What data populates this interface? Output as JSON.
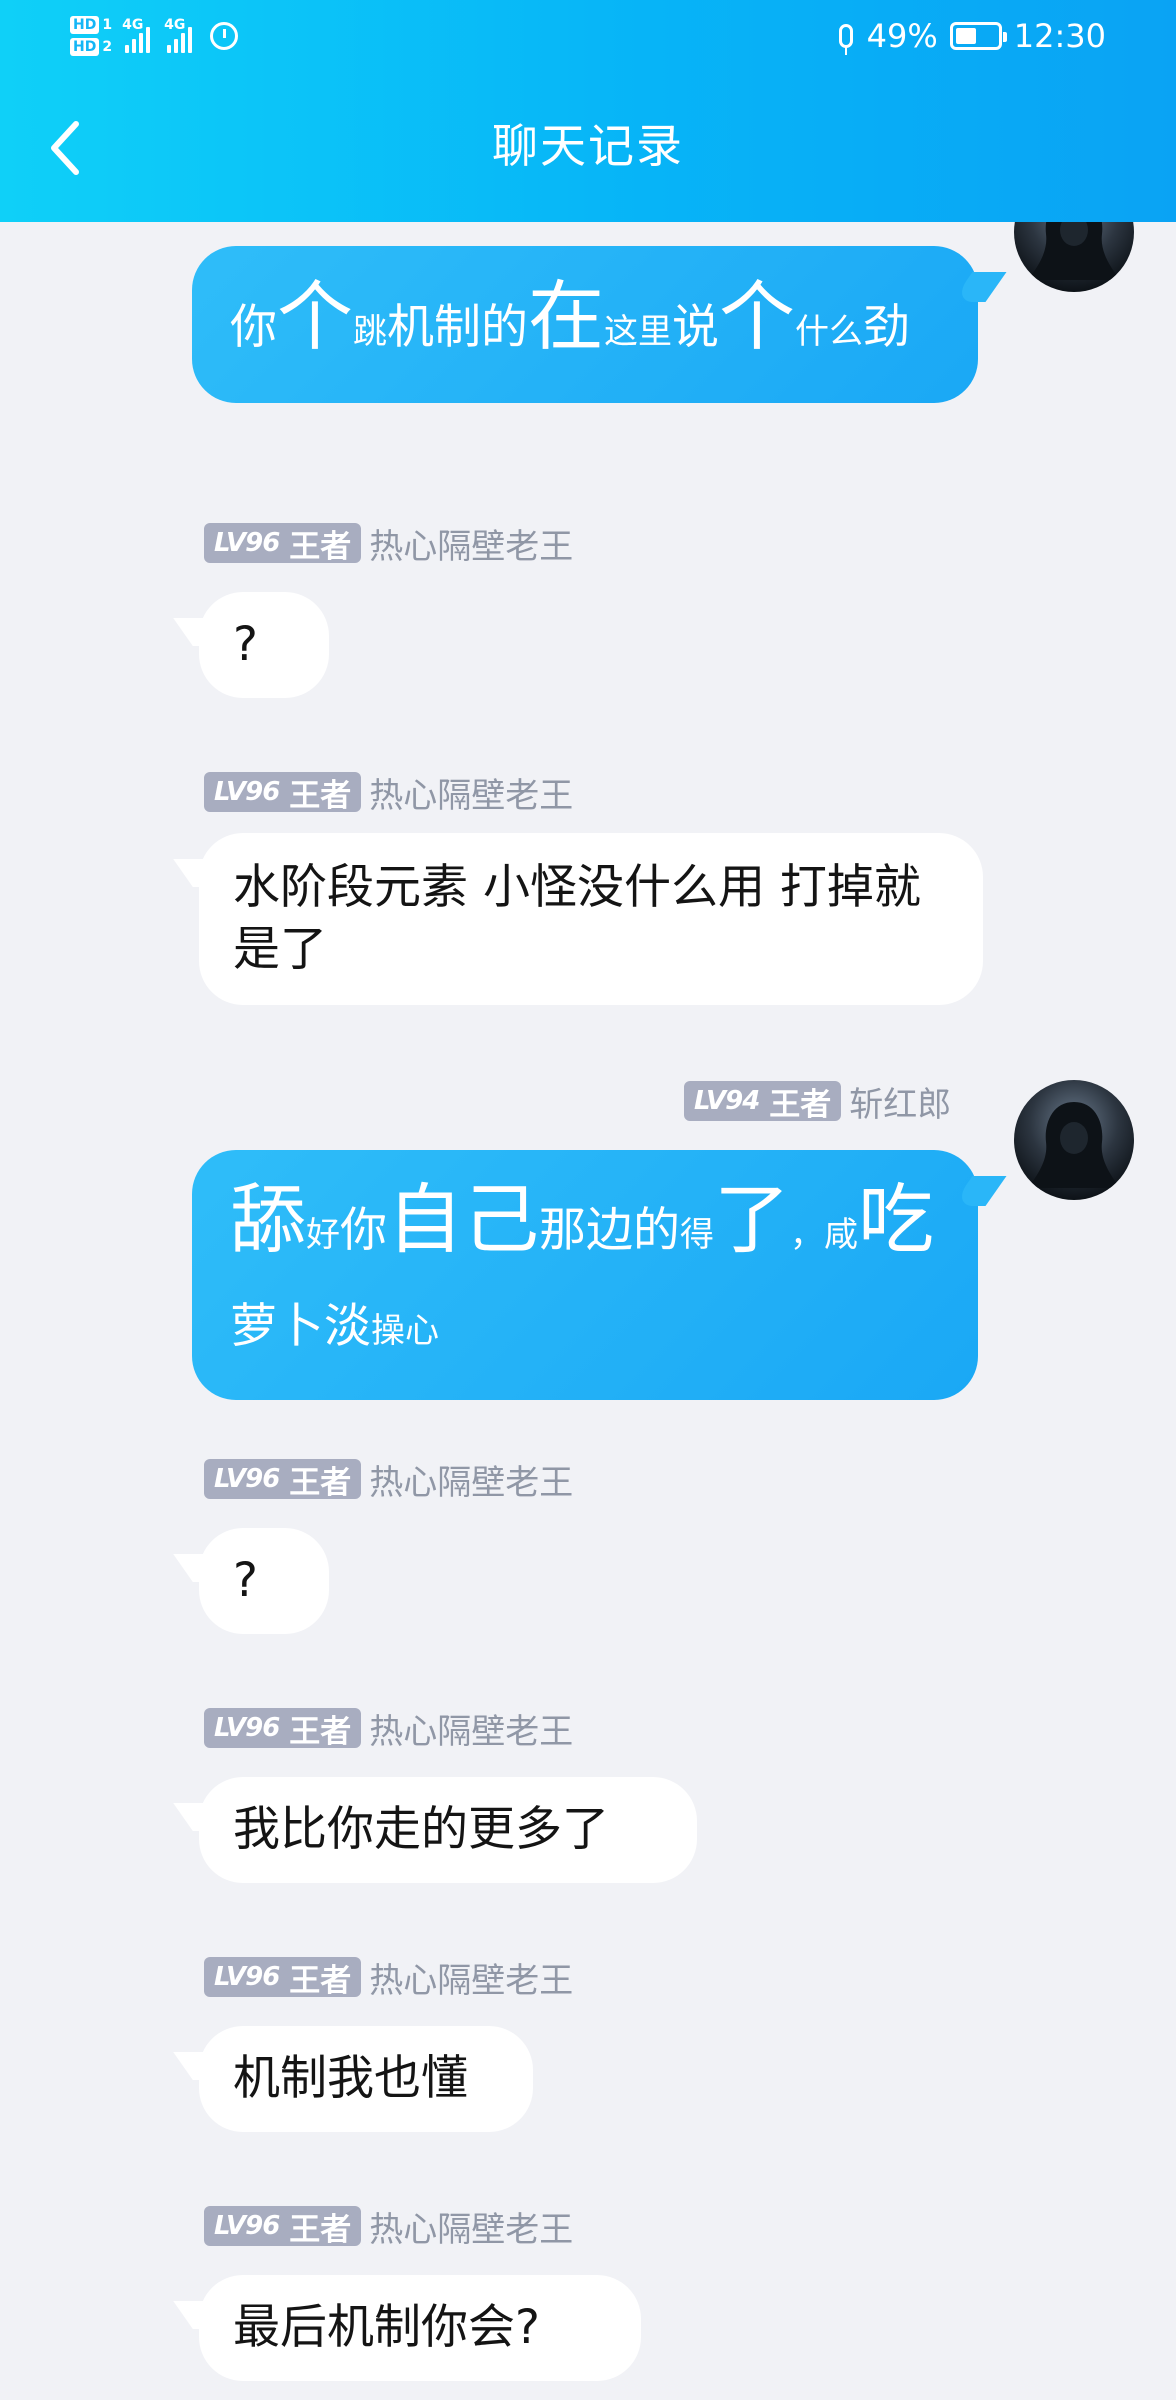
{
  "status_bar": {
    "sim1": "1",
    "sim2": "2",
    "hd": "HD",
    "net1": "4G",
    "net2": "4G",
    "battery_text": "49%",
    "battery_level": 0.49,
    "time": "12:30"
  },
  "header": {
    "title": "聊天记录"
  },
  "messages": [
    {
      "direction": "outgoing",
      "segments": [
        {
          "text": "你",
          "size": "m"
        },
        {
          "text": "个",
          "size": "xl"
        },
        {
          "text": "跳",
          "size": "s"
        },
        {
          "text": "机制的",
          "size": "m"
        },
        {
          "text": "在",
          "size": "xl"
        },
        {
          "text": "这里",
          "size": "s"
        },
        {
          "text": "说",
          "size": "m"
        },
        {
          "text": "个",
          "size": "xl"
        },
        {
          "text": "什么",
          "size": "s"
        },
        {
          "text": "劲",
          "size": "m"
        }
      ]
    },
    {
      "direction": "incoming",
      "level": "LV96",
      "rank": "王者",
      "sender": "热心隔壁老王",
      "text": "?"
    },
    {
      "direction": "incoming",
      "level": "LV96",
      "rank": "王者",
      "sender": "热心隔壁老王",
      "text": "水阶段元素 小怪没什么用 打掉就是了"
    },
    {
      "direction": "outgoing",
      "level": "LV94",
      "rank": "王者",
      "sender": "斩红郎",
      "segments": [
        {
          "text": "舔",
          "size": "xl"
        },
        {
          "text": "好",
          "size": "s"
        },
        {
          "text": "你",
          "size": "m"
        },
        {
          "text": "自己",
          "size": "xl"
        },
        {
          "text": "那边的",
          "size": "m"
        },
        {
          "text": "得",
          "size": "s"
        },
        {
          "text": "了",
          "size": "xl"
        },
        {
          "text": "，",
          "size": "s"
        },
        {
          "text": "咸",
          "size": "s"
        },
        {
          "text": "吃",
          "size": "xl"
        },
        {
          "text": "萝卜淡",
          "size": "m"
        },
        {
          "text": "操心",
          "size": "s"
        }
      ]
    },
    {
      "direction": "incoming",
      "level": "LV96",
      "rank": "王者",
      "sender": "热心隔壁老王",
      "text": "?"
    },
    {
      "direction": "incoming",
      "level": "LV96",
      "rank": "王者",
      "sender": "热心隔壁老王",
      "text": "我比你走的更多了"
    },
    {
      "direction": "incoming",
      "level": "LV96",
      "rank": "王者",
      "sender": "热心隔壁老王",
      "text": "机制我也懂"
    },
    {
      "direction": "incoming",
      "level": "LV96",
      "rank": "王者",
      "sender": "热心隔壁老王",
      "text": "最后机制你会?"
    }
  ],
  "colors": {
    "header_start": "#0fd0f8",
    "header_end": "#0aa3f4",
    "outgoing_bubble": "#1fb0f7",
    "incoming_bubble": "#ffffff",
    "background": "#f1f2f6",
    "badge": "#a8adc0",
    "nickname": "#9097a6"
  },
  "icons": {
    "back": "chevron-left-icon",
    "avatar": "hooded-figure-avatar",
    "microphone": "microphone-icon",
    "alarm": "alarm-icon",
    "battery": "battery-icon"
  }
}
